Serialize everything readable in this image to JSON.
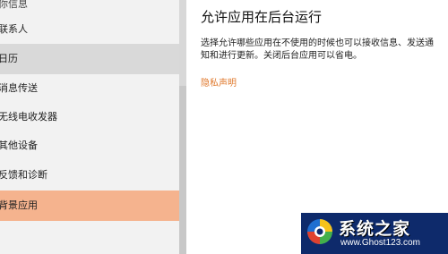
{
  "sidebar": {
    "items": [
      {
        "label": "你信息"
      },
      {
        "label": "联系人"
      },
      {
        "label": "日历"
      },
      {
        "label": "消息传送"
      },
      {
        "label": "无线电收发器"
      },
      {
        "label": "其他设备"
      },
      {
        "label": "反馈和诊断"
      },
      {
        "label": "背景应用"
      }
    ]
  },
  "main": {
    "title": "允许应用在后台运行",
    "description": "选择允许哪些应用在不使用的时候也可以接收信息、发送通知和进行更新。关闭后台应用可以省电。",
    "privacy_link": "隐私声明"
  },
  "watermark": {
    "title": "系统之家",
    "url": "www.Ghost123.com"
  },
  "colors": {
    "accent": "#f5b38e",
    "link": "#e07a2e",
    "selected_gray": "#d9d9d9",
    "sidebar_bg": "#f2f2f2"
  }
}
